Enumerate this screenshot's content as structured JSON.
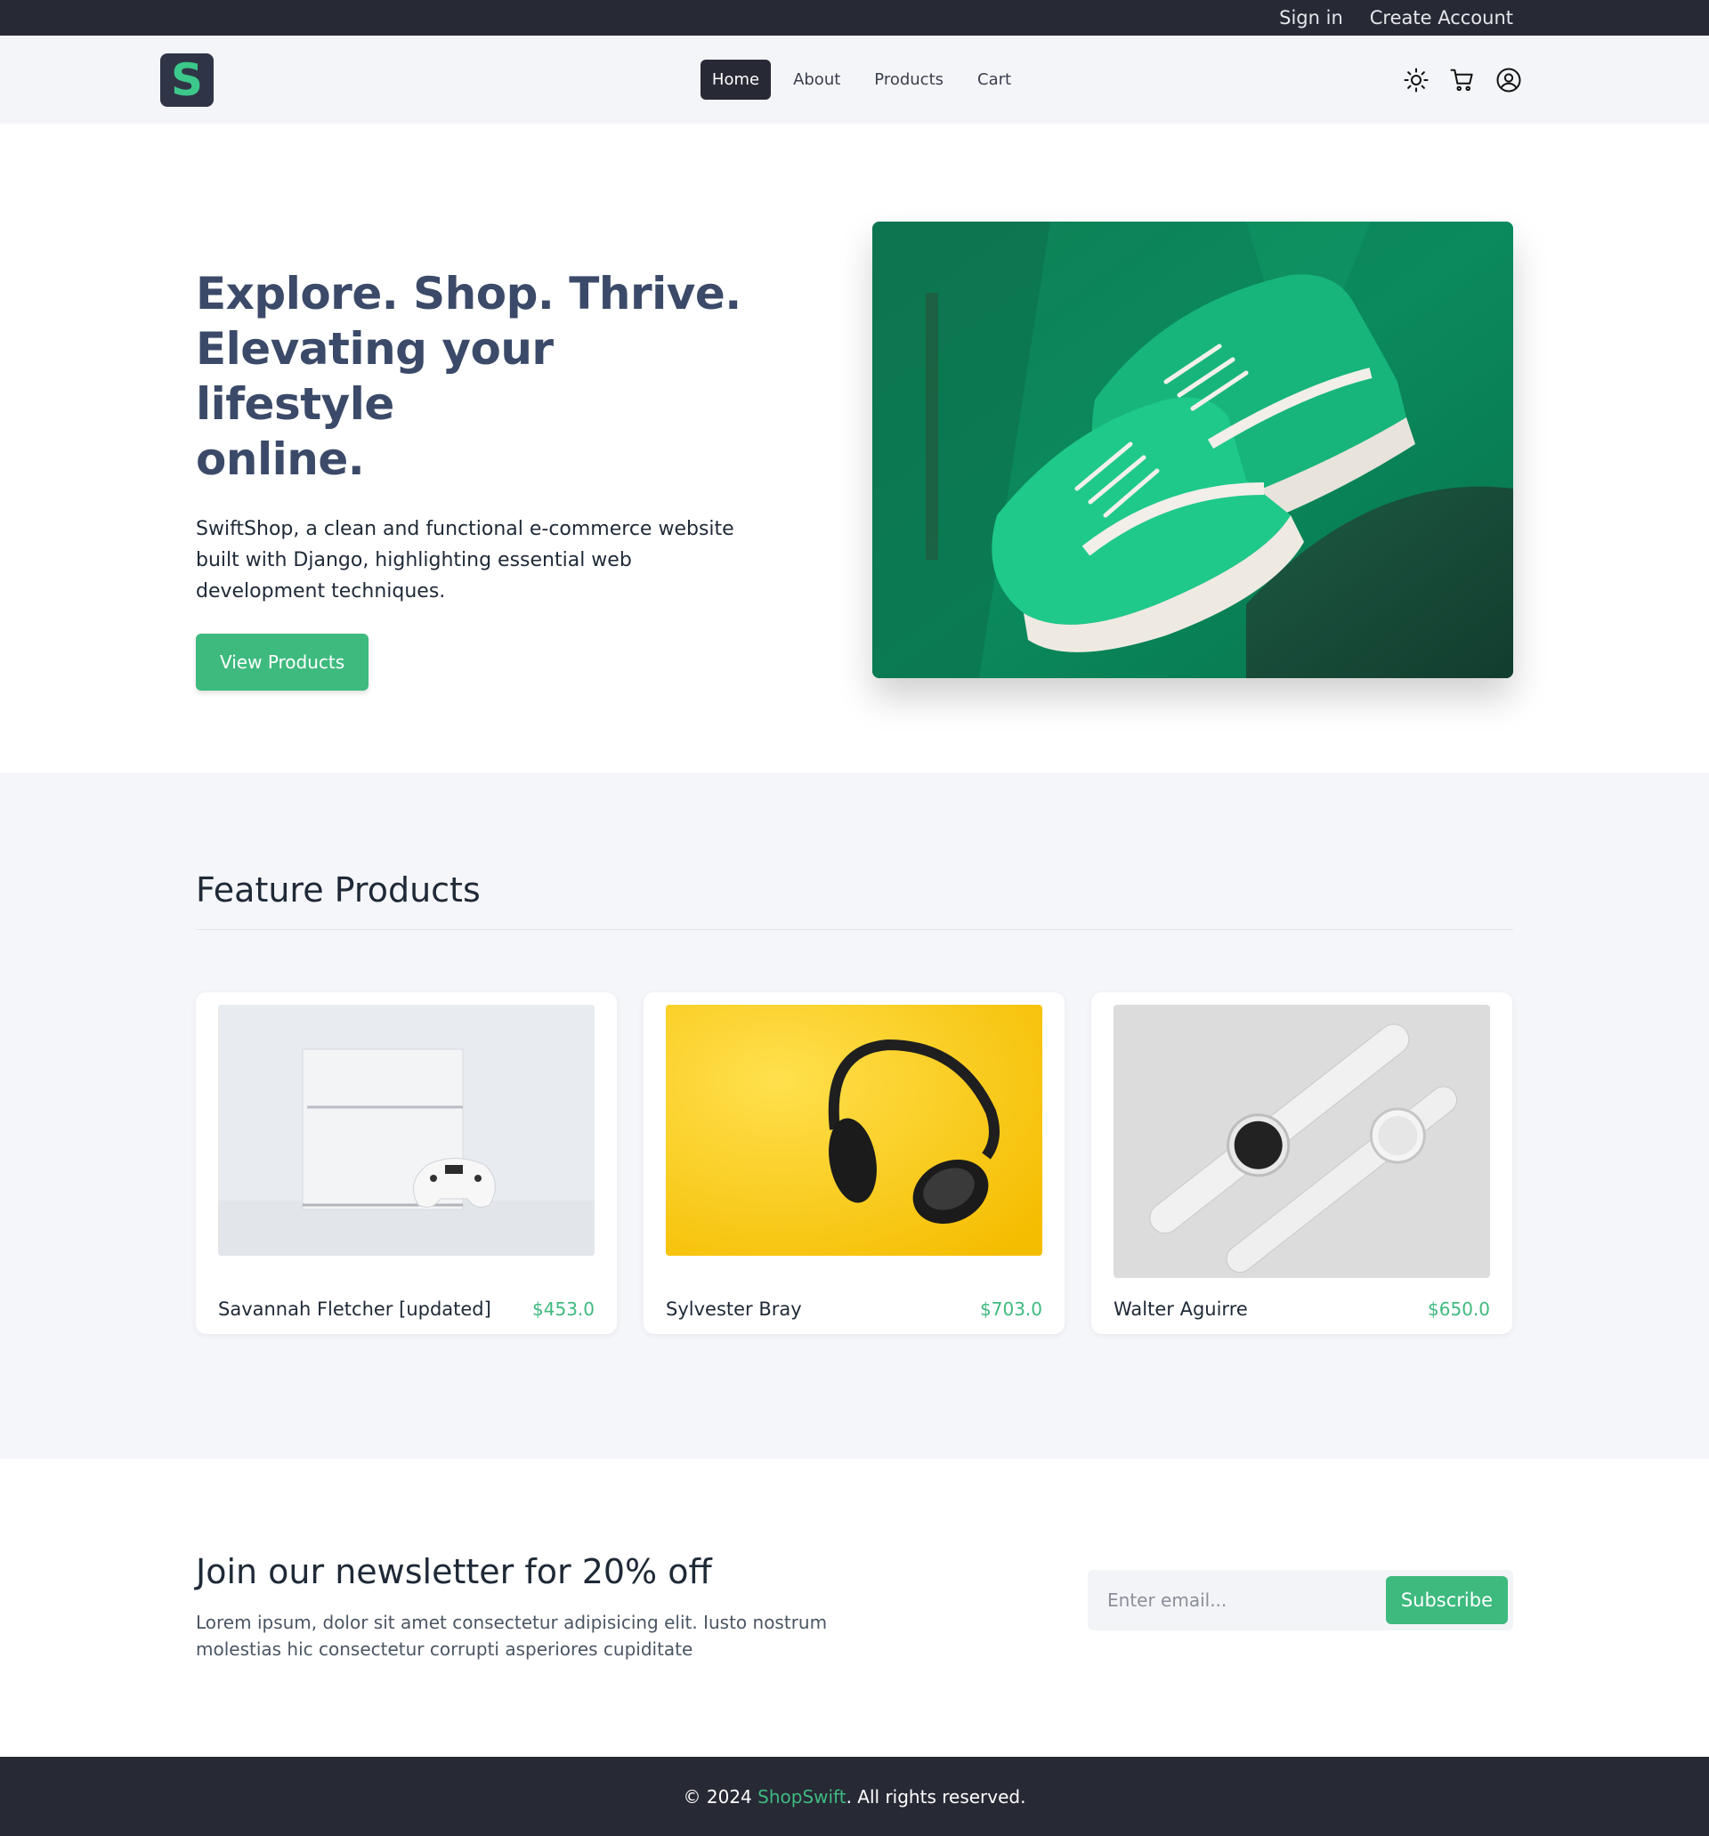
{
  "topbar": {
    "sign_in": "Sign in",
    "create_account": "Create Account"
  },
  "navbar": {
    "logo_letter": "S",
    "links": [
      "Home",
      "About",
      "Products",
      "Cart"
    ],
    "active": "Home",
    "icons": [
      "sun-icon",
      "cart-icon",
      "user-circle-icon"
    ]
  },
  "hero": {
    "title_line1": "Explore. Shop. Thrive.",
    "title_line2": "Elevating your lifestyle",
    "title_line3": "online.",
    "description": "SwiftShop, a clean and functional e-commerce website built with Django, highlighting essential web development techniques.",
    "cta_label": "View Products"
  },
  "featured": {
    "title": "Feature Products",
    "products": [
      {
        "name": "Savannah Fletcher [updated]",
        "price": "$453.0"
      },
      {
        "name": "Sylvester Bray",
        "price": "$703.0"
      },
      {
        "name": "Walter Aguirre",
        "price": "$650.0"
      }
    ]
  },
  "newsletter": {
    "title": "Join our newsletter for 20% off",
    "description": "Lorem ipsum, dolor sit amet consectetur adipisicing elit. Iusto nostrum molestias hic consectetur corrupti asperiores cupiditate",
    "email_placeholder": "Enter email...",
    "subscribe_label": "Subscribe"
  },
  "footer": {
    "prefix": "© 2024 ",
    "brand": "ShopSwift",
    "suffix": ". All rights reserved."
  },
  "colors": {
    "dark": "#272935",
    "accent": "#3eba7f",
    "hero_title": "#3b4a68"
  }
}
